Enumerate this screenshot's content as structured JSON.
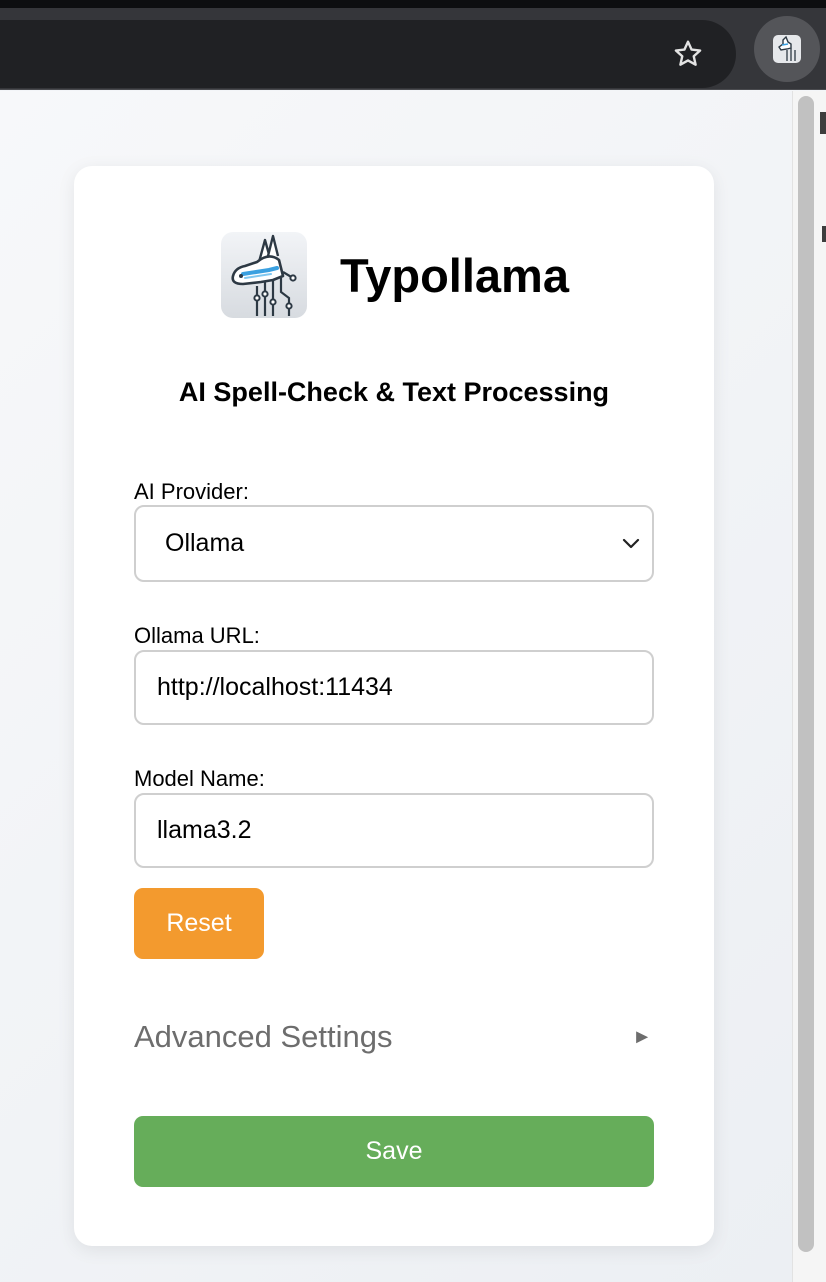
{
  "browser": {
    "bookmark_icon": "star-outline-icon",
    "extension_icon": "typollama-extension-icon"
  },
  "app": {
    "logo_icon": "llama-circuit-logo-icon",
    "title": "Typollama",
    "subtitle": "AI Spell-Check & Text Processing"
  },
  "form": {
    "provider": {
      "label": "AI Provider:",
      "selected": "Ollama"
    },
    "url": {
      "label": "Ollama URL:",
      "value": "http://localhost:11434"
    },
    "model": {
      "label": "Model Name:",
      "value": "llama3.2"
    },
    "reset_label": "Reset",
    "advanced_label": "Advanced Settings",
    "advanced_arrow": "►",
    "save_label": "Save"
  },
  "colors": {
    "reset": "#f39a2e",
    "save": "#66ad5a",
    "logo_accent": "#3aa0e0"
  }
}
